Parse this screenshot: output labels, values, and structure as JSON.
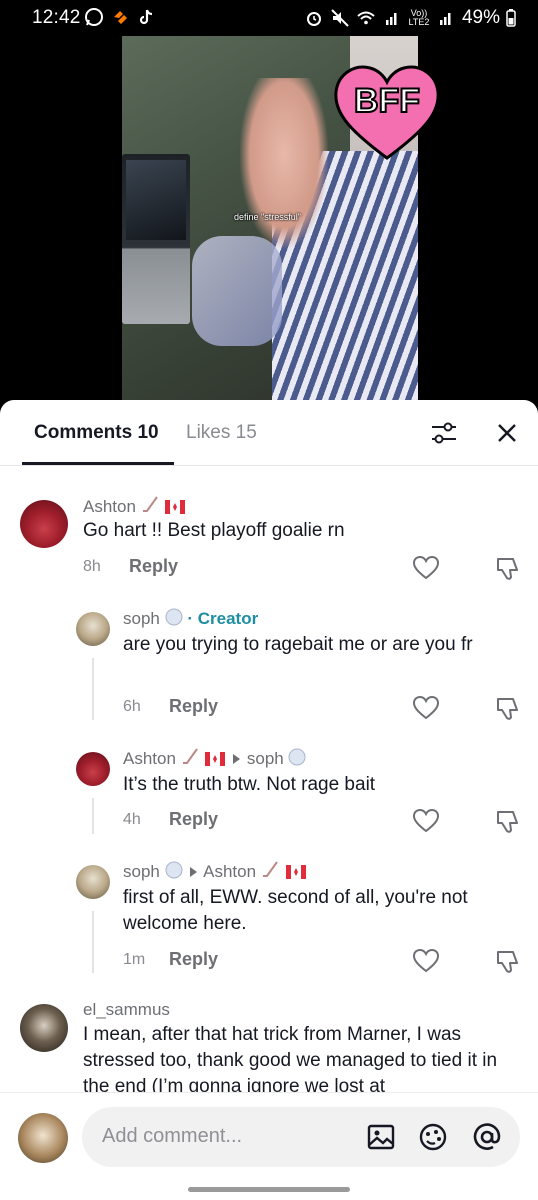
{
  "status_bar": {
    "time": "12:42",
    "carrier_label": "Vo)) LTE2",
    "battery": "49%",
    "icons": [
      "whatsapp-icon",
      "sync-icon",
      "tiktok-icon",
      "alarm-icon",
      "mute-icon",
      "wifi-icon",
      "signal-icon",
      "battery-icon"
    ]
  },
  "video": {
    "overlay_text": "define \"stressful\"",
    "sticker_text": "BFF"
  },
  "tabs": {
    "comments_label": "Comments 10",
    "likes_label": "Likes 15"
  },
  "comments": [
    {
      "username": "Ashton",
      "text": "Go hart !! Best playoff goalie rn",
      "time": "8h",
      "reply_label": "Reply"
    },
    {
      "username": "soph",
      "badge": "· Creator",
      "text": "are you trying to ragebait me or are you fr",
      "time": "6h",
      "reply_label": "Reply"
    },
    {
      "username": "Ashton",
      "reply_to": "soph",
      "text": "It’s the truth btw. Not rage bait",
      "time": "4h",
      "reply_label": "Reply"
    },
    {
      "username": "soph",
      "reply_to": "Ashton",
      "text": "first of all, EWW. second of all, you're not welcome here.",
      "time": "1m",
      "reply_label": "Reply"
    },
    {
      "username": "el_sammus",
      "text": "I mean, after that hat trick from Marner, I was stressed too, thank good we managed to tied it in the end (I’m gonna ignore we lost at"
    }
  ],
  "composer": {
    "placeholder": "Add comment...",
    "icons": [
      "image-icon",
      "emoji-icon",
      "mention-icon"
    ]
  },
  "colors": {
    "creator_accent": "#1f8ea3",
    "sticker_pink": "#f46fb0"
  }
}
